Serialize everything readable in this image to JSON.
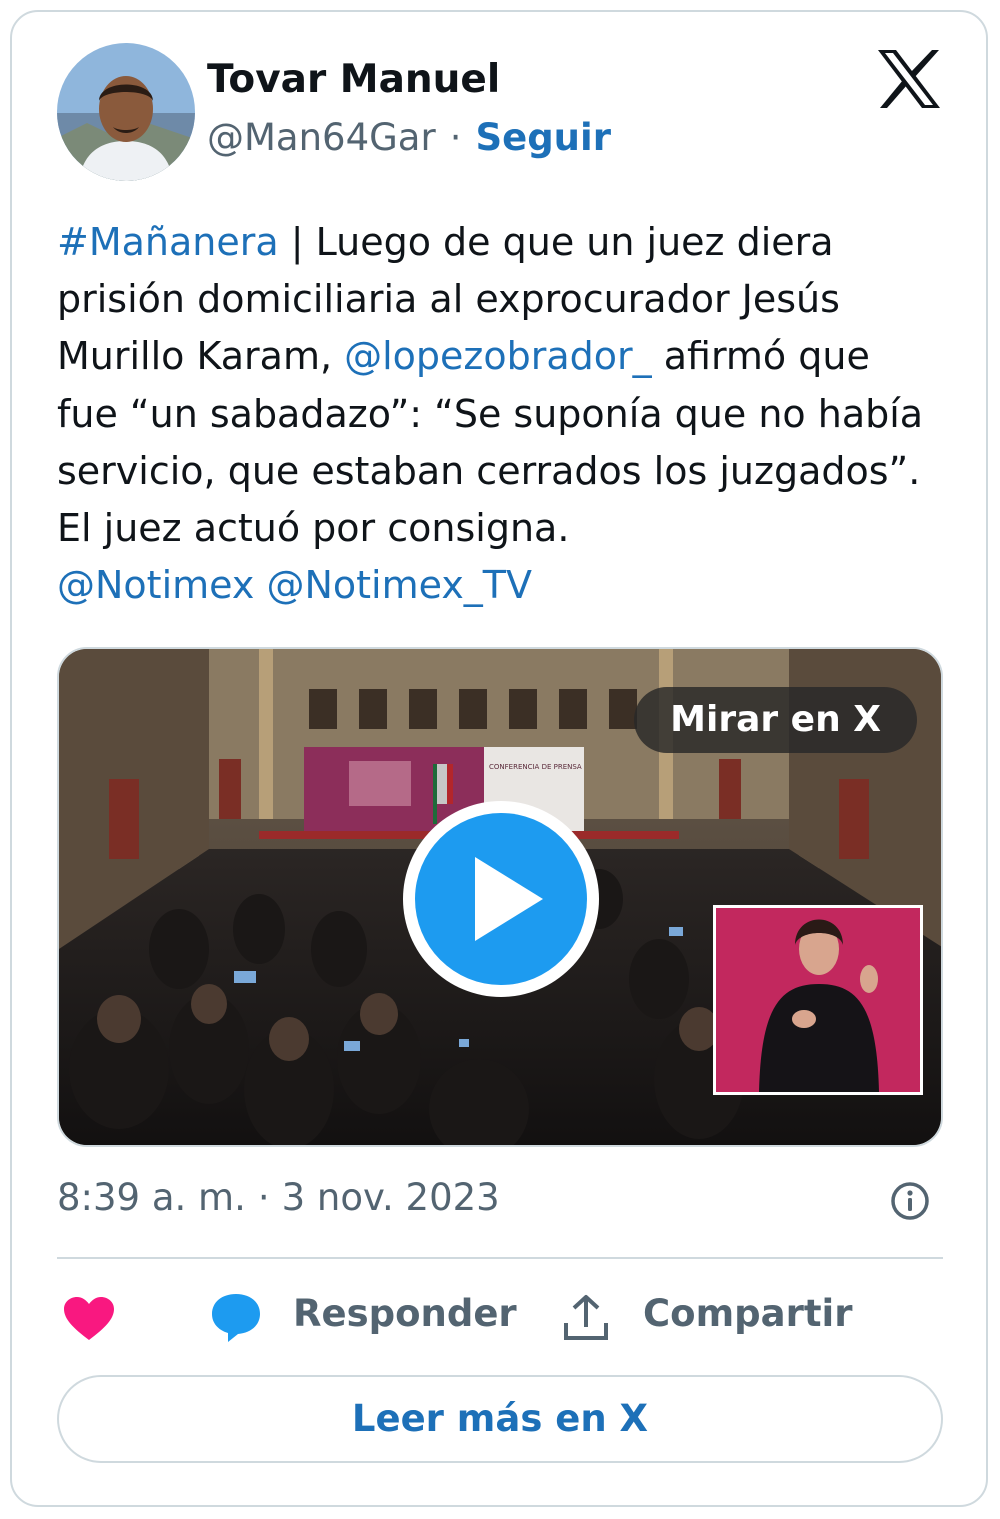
{
  "author": {
    "name": "Tovar Manuel",
    "handle": "@Man64Gar",
    "separator": "·",
    "follow_label": "Seguir"
  },
  "tweet": {
    "line1": {
      "hashtag": "#Mañanera",
      "rest": " | Luego de que un juez diera"
    },
    "line2": "prisión domiciliaria al exprocurador Jesús",
    "line3": {
      "before": "Murillo Karam, ",
      "mention": "@lopezobrador_",
      "after": " afirmó que"
    },
    "line4": "fue “un sabadazo”: “Se suponía que no había",
    "line5": "servicio, que estaban cerrados los juzgados”.",
    "line6": "El juez actuó por consigna.",
    "line7": {
      "mention1": "@Notimex",
      "space": " ",
      "mention2": "@Notimex_TV"
    }
  },
  "media": {
    "watch_label": "Mirar en X",
    "backdrop_text_1": "CONFERENCIA DE PRENSA"
  },
  "meta": {
    "time": "8:39 a. m.",
    "separator": "·",
    "date": "3 nov. 2023"
  },
  "actions": {
    "reply_label": "Responder",
    "share_label": "Compartir",
    "read_more_label": "Leer más en X"
  },
  "icons": {
    "brand": "x-logo-icon",
    "like": "heart-icon",
    "reply": "speech-bubble-icon",
    "share": "upload-icon",
    "info": "info-icon",
    "play": "play-icon"
  },
  "colors": {
    "link": "#1d70b8",
    "secondary_text": "#536471",
    "like": "#f91880",
    "reply": "#1d9bf0",
    "play": "#1d9bf0",
    "border": "#cfd9de"
  }
}
